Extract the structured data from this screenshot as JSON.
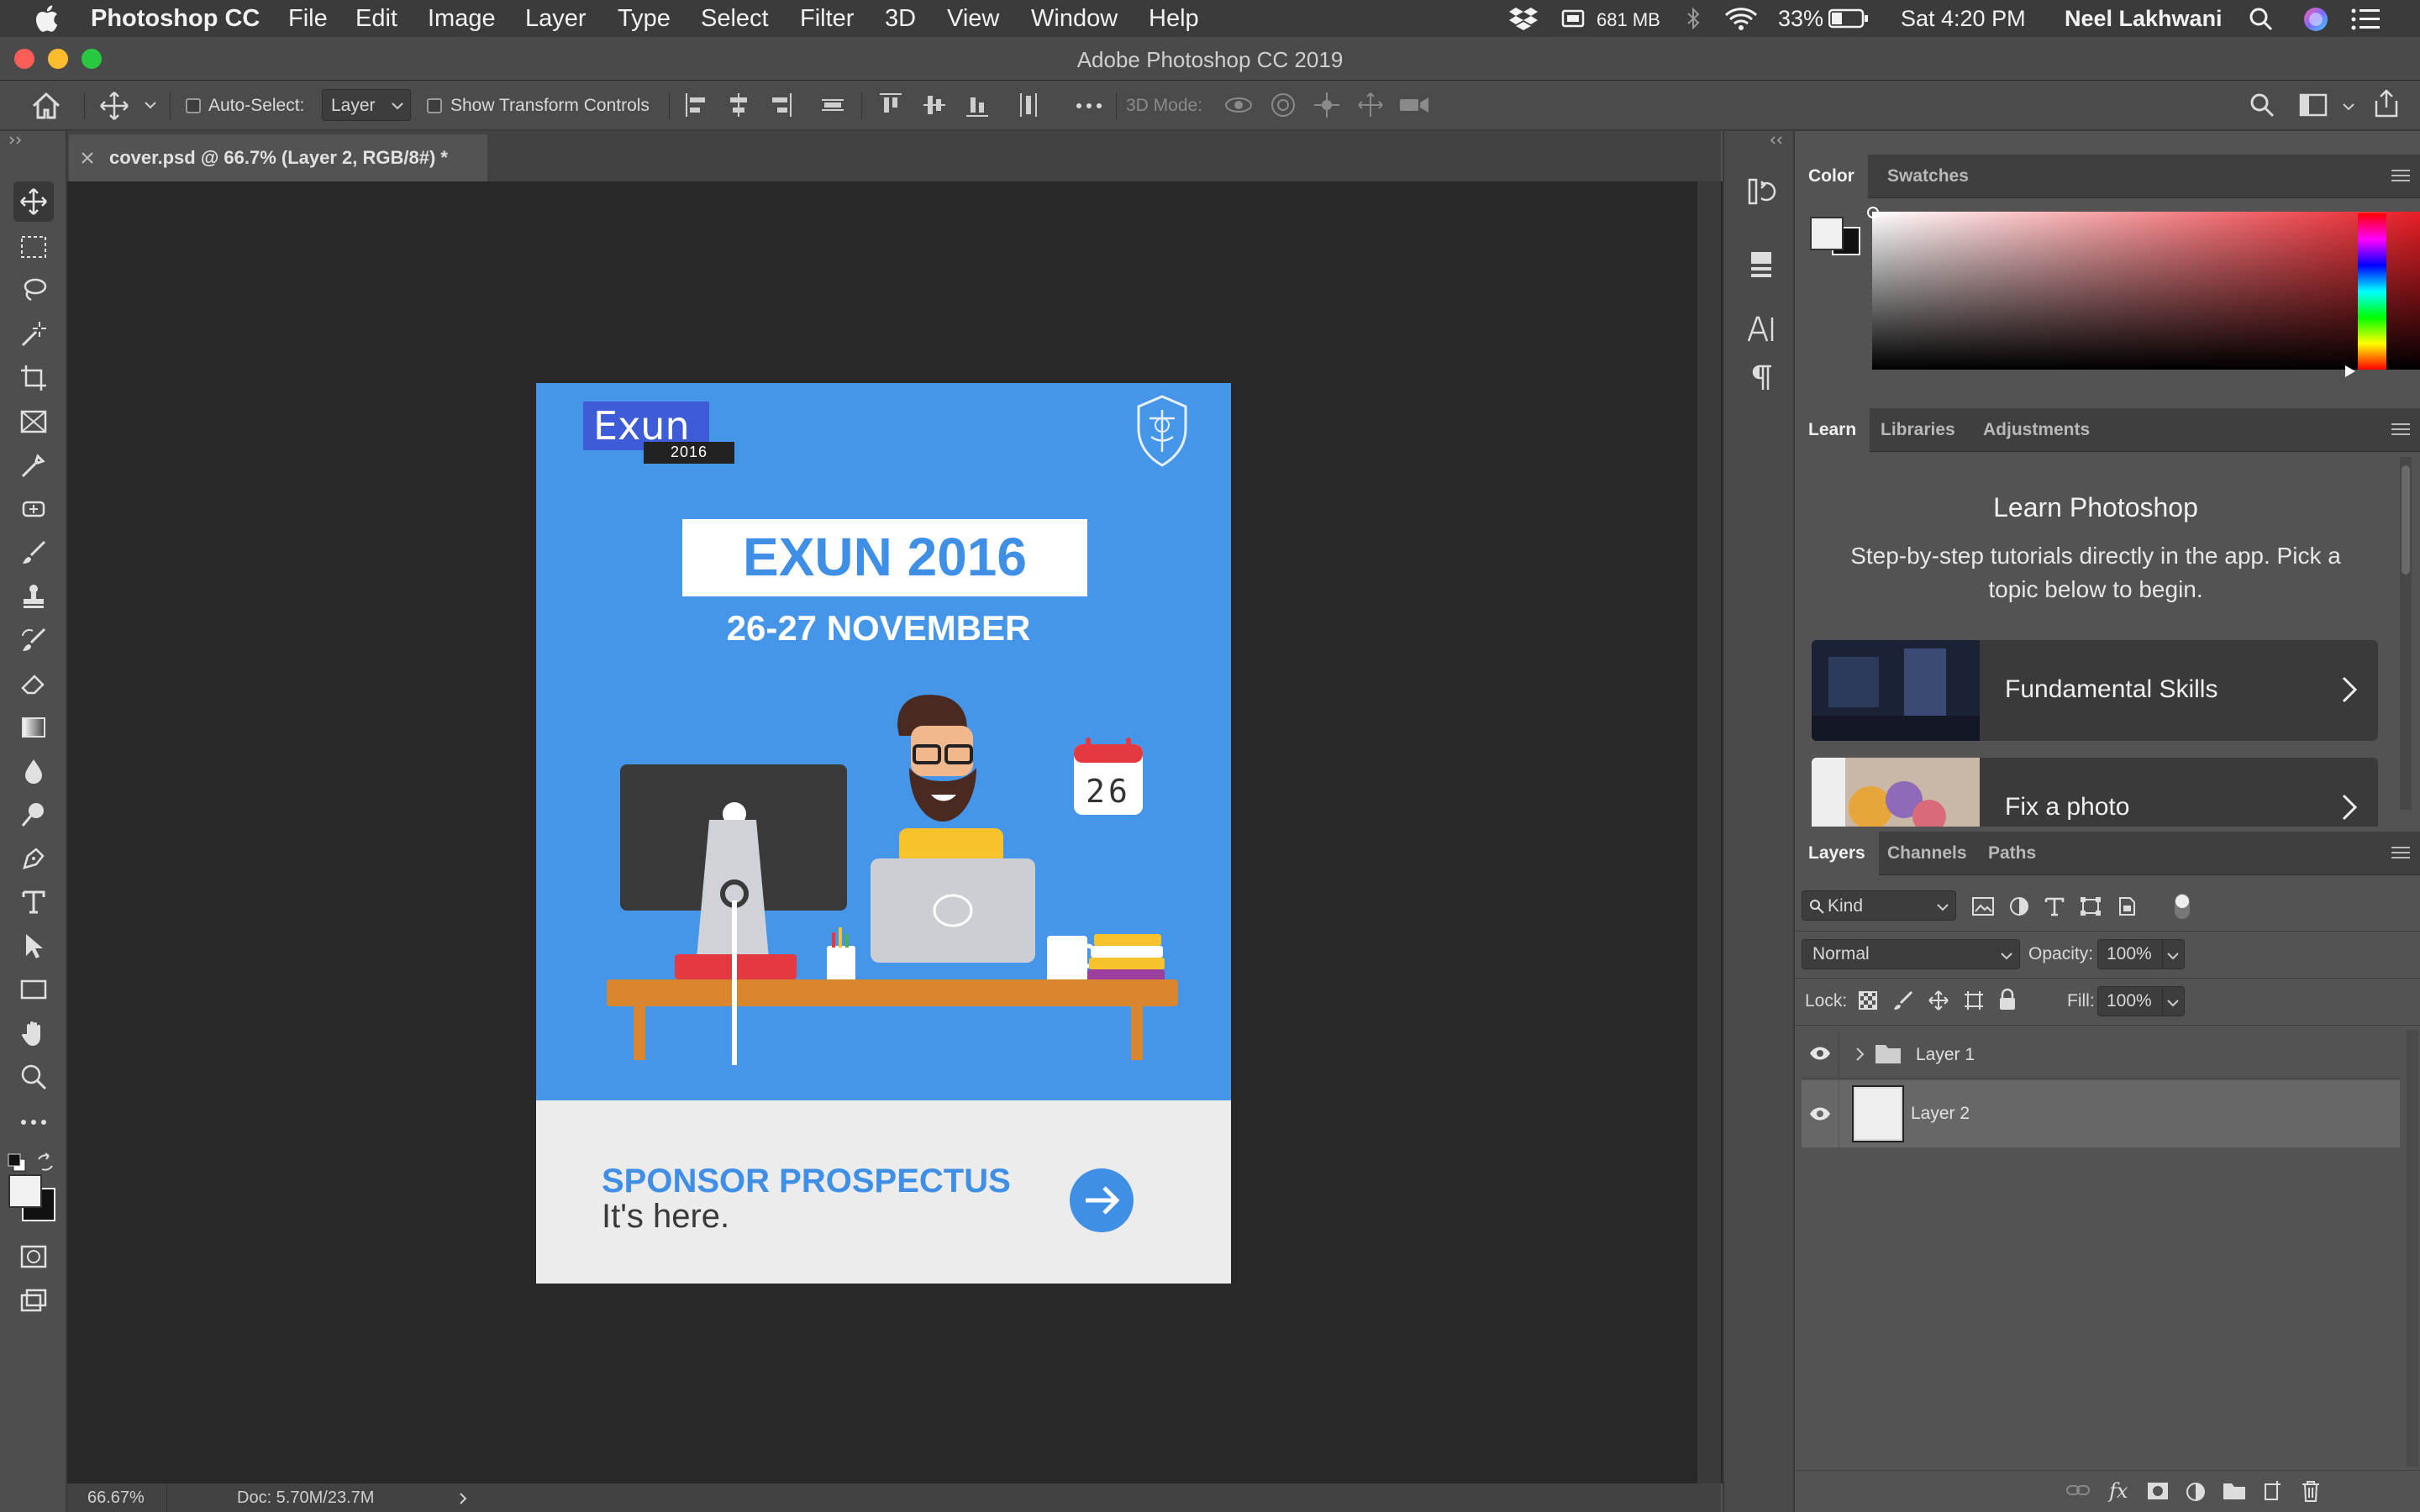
{
  "menubar": {
    "app_name": "Photoshop CC",
    "items": [
      "File",
      "Edit",
      "Image",
      "Layer",
      "Type",
      "Select",
      "Filter",
      "3D",
      "View",
      "Window",
      "Help"
    ],
    "memory": "681 MB",
    "battery": "33%",
    "clock": "Sat 4:20 PM",
    "user": "Neel Lakhwani"
  },
  "window": {
    "title": "Adobe Photoshop CC 2019"
  },
  "options": {
    "auto_select_label": "Auto-Select:",
    "auto_select_value": "Layer",
    "show_transform_label": "Show Transform Controls",
    "mode_3d_label": "3D Mode:"
  },
  "document": {
    "tab_label": "cover.psd @ 66.7% (Layer 2, RGB/8#) *",
    "zoom": "66.67%",
    "doc_size": "Doc: 5.70M/23.7M"
  },
  "artwork": {
    "logo_text": "Exun",
    "logo_year": "2016",
    "headline": "EXUN 2016",
    "dates": "26-27 NOVEMBER",
    "calendar_day": "26",
    "sponsor_title": "SPONSOR PROSPECTUS",
    "sponsor_sub": "It's here."
  },
  "color_panel": {
    "tabs": [
      "Color",
      "Swatches"
    ]
  },
  "learn_panel": {
    "tabs": [
      "Learn",
      "Libraries",
      "Adjustments"
    ],
    "title": "Learn Photoshop",
    "description": "Step-by-step tutorials directly in the app. Pick a topic below to begin.",
    "cards": [
      {
        "label": "Fundamental Skills"
      },
      {
        "label": "Fix a photo"
      }
    ]
  },
  "layers_panel": {
    "tabs": [
      "Layers",
      "Channels",
      "Paths"
    ],
    "kind_label": "Kind",
    "blend_mode": "Normal",
    "opacity_label": "Opacity:",
    "opacity_value": "100%",
    "lock_label": "Lock:",
    "fill_label": "Fill:",
    "fill_value": "100%",
    "layers": [
      {
        "name": "Layer 1",
        "type": "group",
        "visible": true,
        "selected": false
      },
      {
        "name": "Layer 2",
        "type": "pixel",
        "visible": true,
        "selected": true
      }
    ]
  },
  "colors": {
    "accent_blue": "#4596e9",
    "panel_bg": "#535353",
    "canvas_bg": "#282828"
  }
}
